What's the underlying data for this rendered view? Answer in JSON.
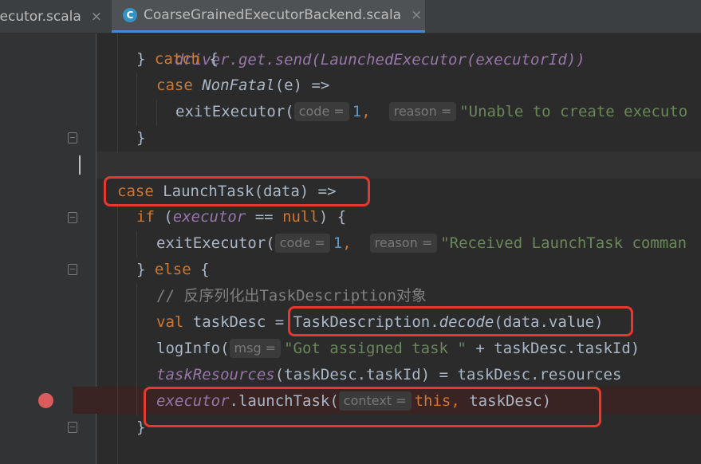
{
  "tabs": [
    {
      "label": "xecutor.scala",
      "close": "×"
    },
    {
      "label": "CoarseGrainedExecutorBackend.scala",
      "close": "×",
      "icon": "scala-class-icon",
      "icon_glyph": "C"
    }
  ],
  "code": {
    "line0": "driver.get.send(LaunchedExecutor(executorId))",
    "line1_brace": "} ",
    "line1_kw": "catch",
    "line1_rest": " {",
    "line2_kw": "case",
    "line2_type": "NonFatal",
    "line2_rest": "(e) =>",
    "line3_fn": "exitExecutor(",
    "line3_hint1": "code =",
    "line3_num": "1",
    "line3_comma": ",",
    "line3_hint2": "reason =",
    "line3_str": "\"Unable to create executo",
    "line4": "}",
    "line6_kw": "case",
    "line6_rest": " LaunchTask(data) =>",
    "line7_kw": "if",
    "line7_a": " (",
    "line7_var": "executor",
    "line7_b": " == ",
    "line7_null": "null",
    "line7_c": ") {",
    "line8_fn": "exitExecutor(",
    "line8_hint1": "code =",
    "line8_num": "1",
    "line8_comma": ",",
    "line8_hint2": "reason =",
    "line8_str": "\"Received LaunchTask comman",
    "line9_brace": "} ",
    "line9_kw": "else",
    "line9_rest": " {",
    "line10_comment": "// 反序列化出TaskDescription对象",
    "line11_kw": "val",
    "line11_a": " taskDesc = ",
    "line11_b": "TaskDescription.",
    "line11_method": "decode",
    "line11_c": "(data.value)",
    "line12_fn": "logInfo(",
    "line12_hint": "msg =",
    "line12_str": "\"Got assigned task \"",
    "line12_rest": " + taskDesc.taskId)",
    "line13_var": "taskResources",
    "line13_rest": "(taskDesc.taskId) = taskDesc.resources",
    "line14_var": "executor",
    "line14_a": ".launchTask(",
    "line14_hint": "context =",
    "line14_kw": "this,",
    "line14_rest": " taskDesc)",
    "line15": "}"
  },
  "colors": {
    "background": "#2b2b2b",
    "keyword": "#cc7832",
    "string": "#6a8759",
    "number": "#6897bb",
    "field": "#9876aa",
    "highlight": "#e8372f",
    "breakpoint": "#db5c5c"
  }
}
